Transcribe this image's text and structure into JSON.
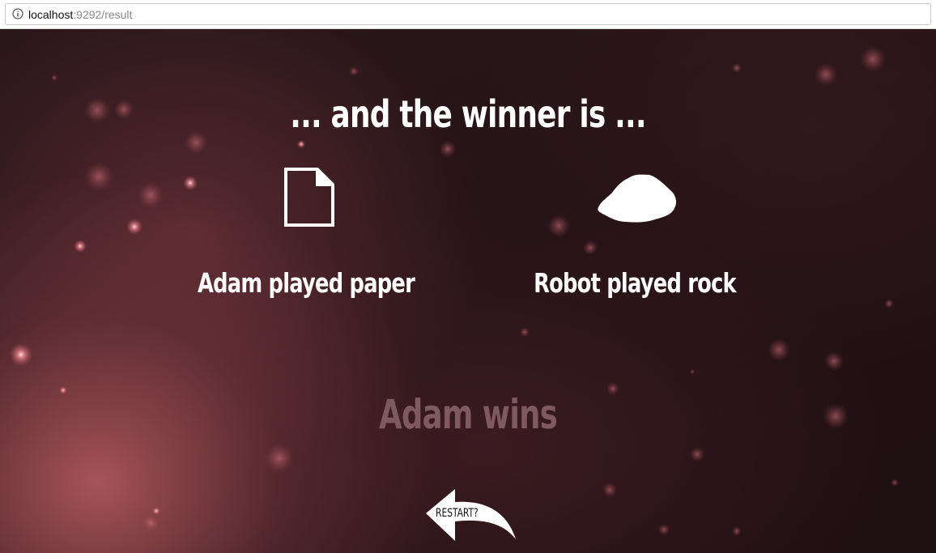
{
  "browser": {
    "url_host": "localhost",
    "url_path": ":9292/result"
  },
  "result": {
    "headline": "... and the winner is ...",
    "player_one": {
      "label": "Adam played paper",
      "move_icon": "paper-icon"
    },
    "player_two": {
      "label": "Robot played rock",
      "move_icon": "rock-icon"
    },
    "winner": "Adam wins",
    "restart_label": "RESTART?"
  },
  "colors": {
    "text": "#ffffff",
    "winner_text": "#7e5a60",
    "background": "#231216"
  }
}
